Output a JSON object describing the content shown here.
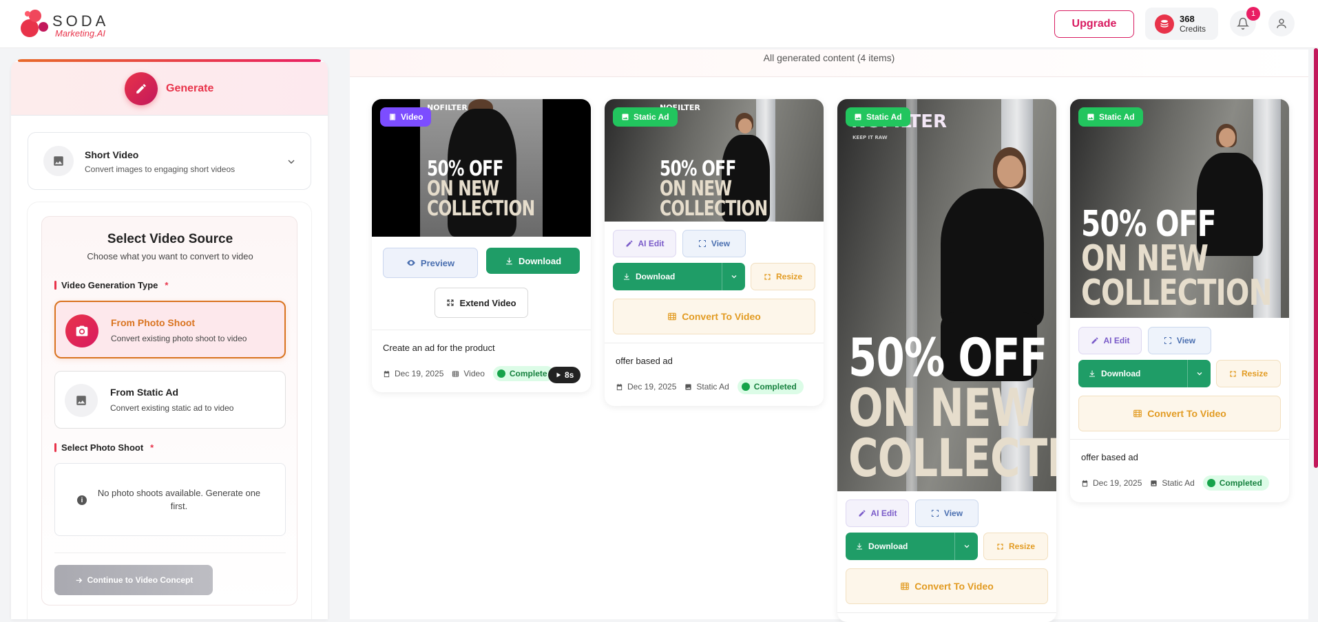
{
  "header": {
    "brand": "SODA",
    "brand_sub": "Marketing.AI",
    "upgrade_label": "Upgrade",
    "credits_value": "368",
    "credits_label": "Credits",
    "notification_count": "1"
  },
  "left": {
    "generate_label": "Generate",
    "type_select": {
      "title": "Short Video",
      "description": "Convert images to engaging short videos"
    },
    "source": {
      "title": "Select Video Source",
      "subtitle": "Choose what you want to convert to video",
      "gen_type_label": "Video Generation Type",
      "required_mark": "*",
      "options": [
        {
          "title": "From Photo Shoot",
          "description": "Convert existing photo shoot to video",
          "selected": true
        },
        {
          "title": "From Static Ad",
          "description": "Convert existing static ad to video",
          "selected": false
        }
      ],
      "photo_shoot_label": "Select Photo Shoot",
      "empty_message": "No photo shoots available. Generate one first.",
      "continue_label": "Continue to Video Concept"
    }
  },
  "content": {
    "header_text": "All generated content (4 items)",
    "ad_brand": "NOFILTER",
    "ad_brand_tag": "KEEP IT RAW",
    "ad_promo": [
      "50% OFF",
      "ON NEW",
      "COLLECTION"
    ],
    "cards": [
      {
        "type_label": "Video",
        "preview_label": "Preview",
        "download_label": "Download",
        "extend_label": "Extend Video",
        "title": "Create an ad for the product",
        "date": "Dec 19, 2025",
        "kind": "Video",
        "status": "Complete",
        "duration": "8s"
      },
      {
        "type_label": "Static Ad",
        "ai_edit_label": "AI Edit",
        "view_label": "View",
        "download_label": "Download",
        "resize_label": "Resize",
        "convert_label": "Convert To Video",
        "title": "offer based ad",
        "date": "Dec 19, 2025",
        "kind": "Static Ad",
        "status": "Completed"
      },
      {
        "type_label": "Static Ad",
        "ai_edit_label": "AI Edit",
        "view_label": "View",
        "download_label": "Download",
        "resize_label": "Resize",
        "convert_label": "Convert To Video"
      },
      {
        "type_label": "Static Ad",
        "ai_edit_label": "AI Edit",
        "view_label": "View",
        "download_label": "Download",
        "resize_label": "Resize",
        "convert_label": "Convert To Video",
        "title": "offer based ad",
        "date": "Dec 19, 2025",
        "kind": "Static Ad",
        "status": "Completed"
      }
    ]
  },
  "colors": {
    "brand": "#e8334a",
    "accent_pink": "#d81b60",
    "download_green": "#1f9d67",
    "static_tag": "#22c55e",
    "video_tag": "#7c4dff",
    "convert_orange": "#e29b22"
  },
  "icons": [
    "pencil-icon",
    "image-icon",
    "chevron-down-icon",
    "camera-icon",
    "info-icon",
    "arrow-right-icon",
    "film-icon",
    "eye-icon",
    "download-icon",
    "expand-icon",
    "maximize-icon",
    "calendar-icon",
    "play-icon",
    "bell-icon",
    "user-icon",
    "coin-stack-icon"
  ]
}
